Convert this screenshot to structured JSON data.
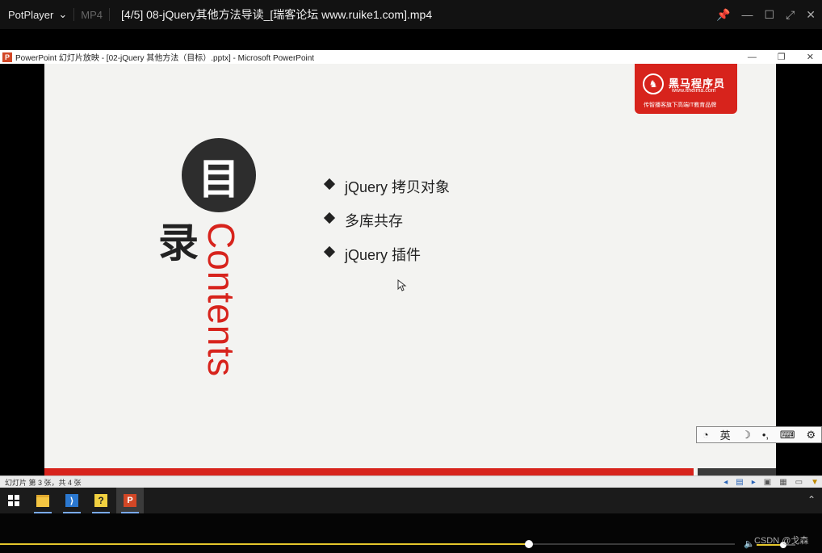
{
  "player": {
    "app_name": "PotPlayer",
    "format": "MP4",
    "title": "[4/5] 08-jQuery其他方法导读_[瑞客论坛 www.ruike1.com].mp4",
    "controls": [
      "pin",
      "minimize",
      "maximize",
      "fullscreen",
      "close"
    ],
    "progress": 0.72,
    "volume": 0.68,
    "watermark": "CSDN @戈森"
  },
  "ppt": {
    "window_title": "PowerPoint 幻灯片放映 - [02-jQuery 其他方法（目标）.pptx] - Microsoft PowerPoint",
    "icon_letter": "P",
    "status_text": "幻灯片 第 3 张，共 4 张"
  },
  "slide": {
    "logo": {
      "name": "黑马程序员",
      "url": "www.itheima.com",
      "slogan": "传智播客旗下高端IT教育品牌"
    },
    "title_char_1": "目",
    "title_char_2": "录",
    "contents_word": "Contents",
    "agenda": [
      "jQuery 拷贝对象",
      "多库共存",
      "jQuery 插件"
    ],
    "colors": {
      "accent": "#d7231c",
      "dark": "#2d2d2d",
      "background": "#f3f3f1"
    }
  },
  "ime_toolbar": {
    "items": [
      "logo",
      "英",
      "☽",
      "•,",
      "keyboard",
      "settings"
    ],
    "language_label": "英"
  },
  "taskbar": {
    "apps": [
      "start",
      "file-explorer",
      "visual-studio-code",
      "help-tool",
      "powerpoint"
    ]
  }
}
